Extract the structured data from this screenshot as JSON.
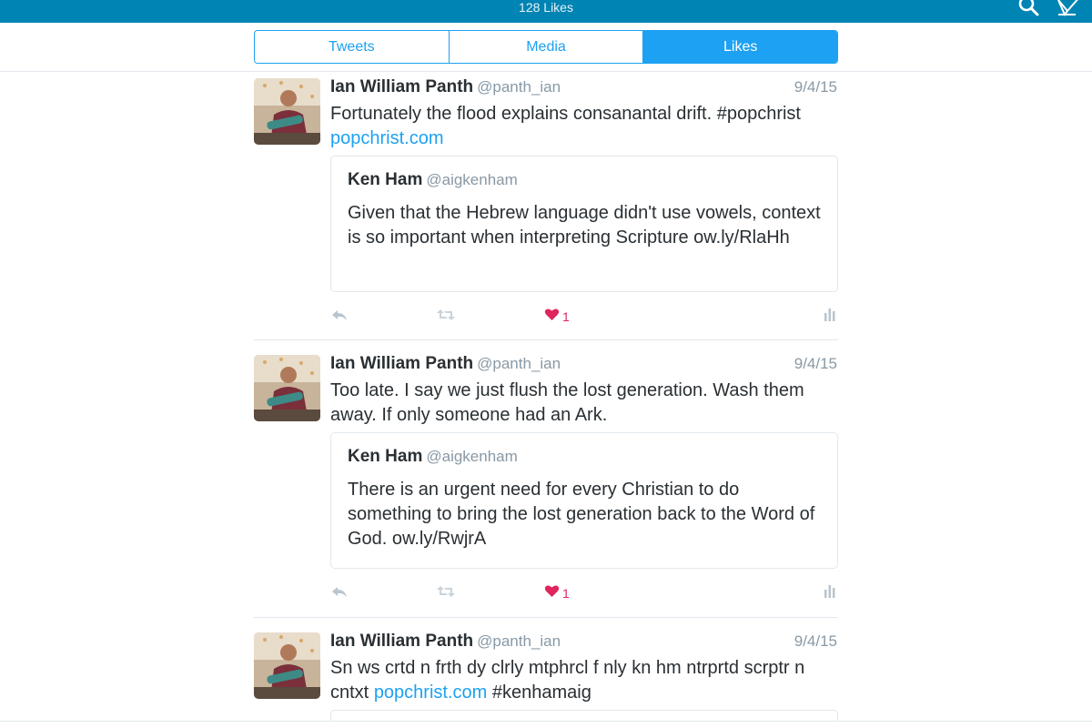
{
  "header": {
    "likes_count": "128 Likes",
    "search_icon": "search-icon",
    "compose_icon": "compose-icon",
    "color": "#0084b4"
  },
  "tabs": [
    {
      "label": "Tweets",
      "active": false
    },
    {
      "label": "Media",
      "active": false
    },
    {
      "label": "Likes",
      "active": true
    }
  ],
  "tweets": [
    {
      "name": "Ian William Panth",
      "handle": "@panth_ian",
      "date": "9/4/15",
      "text": "Fortunately the flood explains consanantal drift. #popchrist",
      "link": "popchrist.com",
      "quote": {
        "name": "Ken Ham",
        "handle": "@aigkenham",
        "text": "Given that the Hebrew language didn't use vowels, context is so important when interpreting Scripture ow.ly/RlaHh"
      },
      "likes": "1"
    },
    {
      "name": "Ian William Panth",
      "handle": "@panth_ian",
      "date": "9/4/15",
      "text": "Too late. I say we just flush the lost generation. Wash them away. If only someone had an Ark.",
      "quote": {
        "name": "Ken Ham",
        "handle": "@aigkenham",
        "text": "There is an urgent need for every Christian to do something to bring the lost generation back to the Word of God. ow.ly/RwjrA"
      },
      "likes": "1"
    },
    {
      "name": "Ian William Panth",
      "handle": "@panth_ian",
      "date": "9/4/15",
      "text_before": "Sn ws crtd n frth dy clrly mtphrcl f nly kn hm ntrprtd scrptr n cntxt",
      "link": "popchrist.com",
      "text_after": "#kenhamaig"
    }
  ],
  "colors": {
    "accent": "#1da1f2",
    "like": "#e0245e",
    "muted": "#8899a6",
    "border": "#e1e8ed"
  }
}
